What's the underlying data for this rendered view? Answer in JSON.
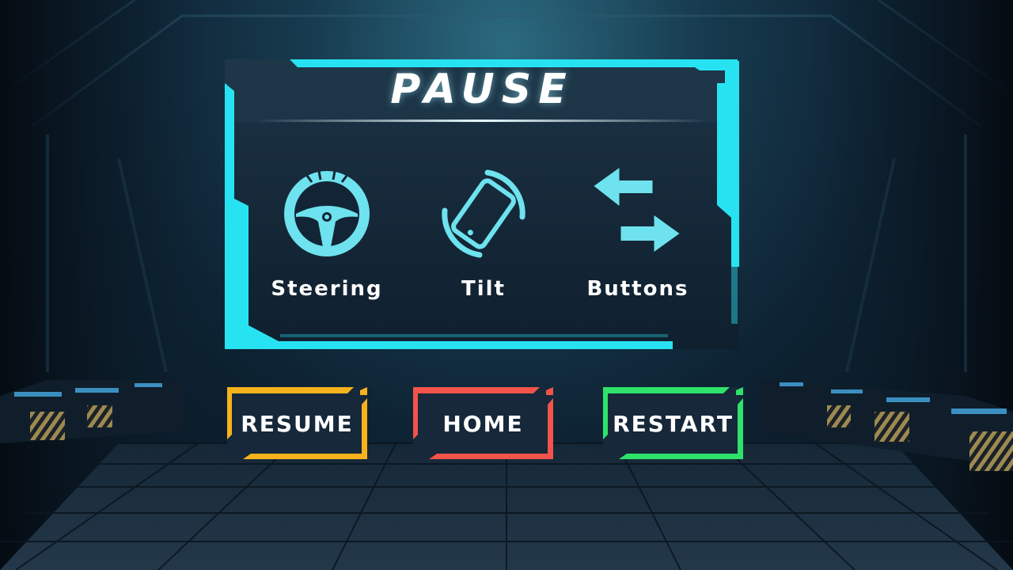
{
  "pause_menu": {
    "title": "PAUSE",
    "controls": [
      {
        "label": "Steering",
        "icon": "steering-wheel-icon"
      },
      {
        "label": "Tilt",
        "icon": "tilt-phone-icon"
      },
      {
        "label": "Buttons",
        "icon": "arrow-buttons-icon"
      }
    ],
    "accent_color": "#27e3f2"
  },
  "buttons": [
    {
      "label": "RESUME",
      "color": "#f7b21c"
    },
    {
      "label": "HOME",
      "color": "#f2534b"
    },
    {
      "label": "RESTART",
      "color": "#2fe26a"
    }
  ]
}
